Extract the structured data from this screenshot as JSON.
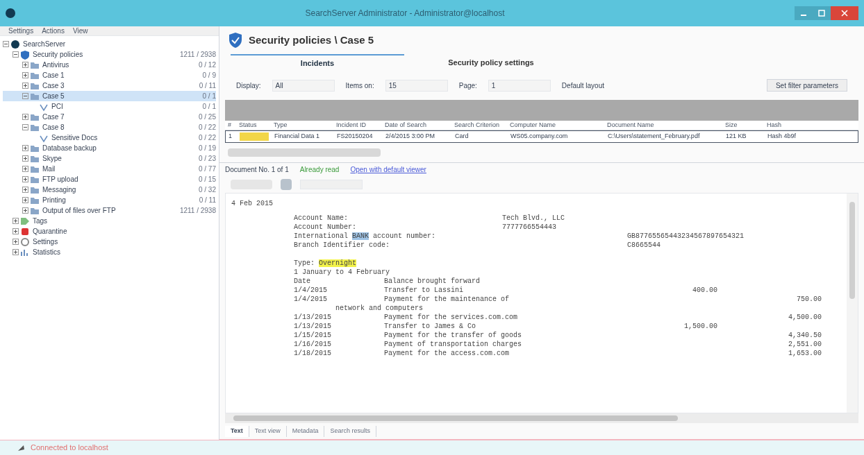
{
  "window": {
    "title": "SearchServer Administrator - Administrator@localhost"
  },
  "menu": [
    "Settings",
    "Actions",
    "View"
  ],
  "tree": [
    {
      "label": "SearchServer",
      "kind": "server",
      "expanded": true,
      "children": [
        {
          "label": "Security policies",
          "kind": "shield",
          "count": "1211 / 2938",
          "expanded": true,
          "children": [
            {
              "label": "Antivirus",
              "kind": "folder",
              "count": "0 / 12",
              "expanded": false,
              "selected": false
            },
            {
              "label": "Case 1",
              "kind": "folder",
              "count": "0 / 9",
              "expanded": false,
              "selected": false
            },
            {
              "label": "Case 3",
              "kind": "folder",
              "count": "0 / 11",
              "expanded": false,
              "selected": false
            },
            {
              "label": "Case 5",
              "kind": "folder",
              "count": "0 / 1",
              "expanded": true,
              "selected": true,
              "children": [
                {
                  "label": "PCI",
                  "kind": "query",
                  "count": "0 / 1"
                }
              ]
            },
            {
              "label": "Case 7",
              "kind": "folder",
              "count": "0 / 25",
              "expanded": false,
              "selected": false
            },
            {
              "label": "Case 8",
              "kind": "folder",
              "count": "0 / 22",
              "expanded": true,
              "selected": false,
              "children": [
                {
                  "label": "Sensitive Docs",
                  "kind": "query",
                  "count": "0 / 22"
                }
              ]
            },
            {
              "label": "Database backup",
              "kind": "folder",
              "count": "0 / 19",
              "expanded": false,
              "selected": false
            },
            {
              "label": "Skype",
              "kind": "folder",
              "count": "0 / 23",
              "expanded": false,
              "selected": false
            },
            {
              "label": "Mail",
              "kind": "folder",
              "count": "0 / 77",
              "expanded": false,
              "selected": false
            },
            {
              "label": "FTP upload",
              "kind": "folder",
              "count": "0 / 15",
              "expanded": false,
              "selected": false
            },
            {
              "label": "Messaging",
              "kind": "folder",
              "count": "0 / 32",
              "expanded": false,
              "selected": false
            },
            {
              "label": "Printing",
              "kind": "folder",
              "count": "0 / 11",
              "expanded": false,
              "selected": false
            },
            {
              "label": "Output of files over FTP",
              "kind": "folder",
              "count": "1211 / 2938",
              "expanded": false,
              "selected": false
            }
          ]
        },
        {
          "label": "Tags",
          "kind": "tag",
          "expanded": false
        },
        {
          "label": "Quarantine",
          "kind": "quarantine",
          "expanded": false
        },
        {
          "label": "Settings",
          "kind": "settings",
          "expanded": false
        },
        {
          "label": "Statistics",
          "kind": "stats",
          "expanded": false
        }
      ]
    }
  ],
  "header": {
    "title": "Security policies \\ Case 5"
  },
  "tabs": [
    {
      "label": "Incidents",
      "selected": true
    },
    {
      "label": "Security policy settings",
      "selected": false
    }
  ],
  "filters": [
    {
      "label": "Display:",
      "value": "All"
    },
    {
      "label": "Items on:",
      "value": "15"
    },
    {
      "label": "Page:",
      "value": "1"
    },
    {
      "label": "Default layout"
    }
  ],
  "filter_button": "Set filter parameters",
  "table": {
    "columns": [
      "#",
      "Status",
      "Type",
      "Incident ID",
      "Date of Search",
      "Search Criterion",
      "Computer Name",
      "Document Name",
      "Size",
      "Hash"
    ],
    "rows": [
      {
        "selected": true,
        "cells": [
          "1",
          "",
          "Financial Data 1",
          "FS20150204",
          "2/4/2015 3:00 PM",
          "Card",
          "WS05.company.com",
          "C:\\Users\\statement_February.pdf",
          "121 KB",
          "Hash 4b9f"
        ]
      }
    ]
  },
  "doc_status": {
    "counter": "Document No. 1 of 1",
    "state": "Already read",
    "link": "Open with default viewer"
  },
  "document": [
    {
      "kind": "text",
      "text": "4 Feb 2015"
    },
    {
      "kind": "field",
      "label": [
        {
          "text": "Account Name:"
        }
      ],
      "value": "Tech Blvd., LLC"
    },
    {
      "kind": "field",
      "label": [
        {
          "text": "Account Number:"
        }
      ],
      "value": "7777766554443"
    },
    {
      "kind": "field",
      "label": [
        {
          "text": "International "
        },
        {
          "text": "BANK",
          "color": "#9ec3e6"
        },
        {
          "text": " account number:"
        }
      ],
      "right": "GB87765565443234567897654321"
    },
    {
      "kind": "field",
      "label": [
        {
          "text": "Branch Identifier code:"
        }
      ],
      "right": "C8665544"
    },
    {
      "kind": "gap"
    },
    {
      "kind": "field",
      "label": [
        {
          "text": "Type: "
        },
        {
          "text": "Overnight",
          "color": "#f2f24a"
        }
      ]
    },
    {
      "kind": "field",
      "label": [
        {
          "text": "1 January to 4 February"
        }
      ]
    },
    {
      "kind": "row",
      "date": "Date",
      "text": "Balance brought forward"
    },
    {
      "kind": "row",
      "date": "1/4/2015",
      "text": "Transfer to Lassini",
      "debit": "400.00"
    },
    {
      "kind": "row",
      "date": "1/4/2015",
      "text": "Payment for the maintenance of",
      "credit": "750.00"
    },
    {
      "kind": "cont",
      "text": "network and computers"
    },
    {
      "kind": "row",
      "date": "1/13/2015",
      "text": "Payment for the services.com.com",
      "credit": "4,500.00"
    },
    {
      "kind": "row",
      "date": "1/13/2015",
      "text": "Transfer to James & Co",
      "debit": "1,500.00"
    },
    {
      "kind": "row",
      "date": "1/15/2015",
      "text": "Payment for the transfer of goods",
      "credit": "4,340.50"
    },
    {
      "kind": "row",
      "date": "1/16/2015",
      "text": "Payment of transportation charges",
      "credit": "2,551.00"
    },
    {
      "kind": "row",
      "date": "1/18/2015",
      "text": "Payment for the access.com.com",
      "credit": "1,653.00"
    }
  ],
  "bottom_tabs": [
    {
      "label": "Text",
      "selected": true
    },
    {
      "label": "Text view",
      "selected": false
    },
    {
      "label": "Metadata",
      "selected": false
    },
    {
      "label": "Search results",
      "selected": false
    }
  ],
  "status_bar": {
    "text": "Connected to localhost"
  }
}
